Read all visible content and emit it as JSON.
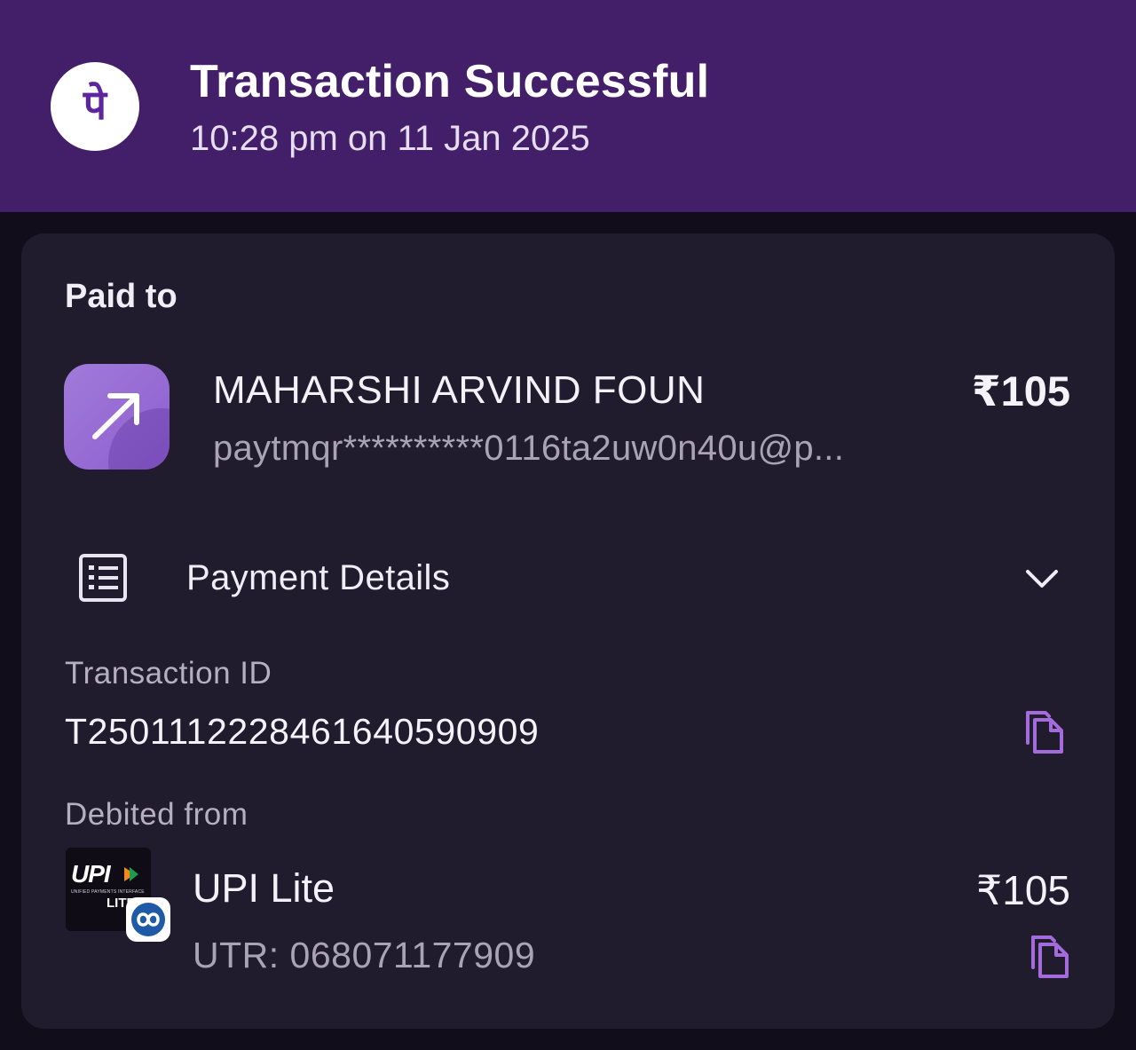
{
  "header": {
    "title": "Transaction Successful",
    "subtitle": "10:28 pm on 11 Jan 2025",
    "logo_glyph": "पे",
    "colors": {
      "background": "#431e69",
      "logo_fg": "#5f259f"
    }
  },
  "paid_to": {
    "label": "Paid to",
    "payee_name": "MAHARSHI ARVIND FOUN",
    "payee_upi": "paytmqr**********0116ta2uw0n40u@p...",
    "amount": "₹105",
    "avatar_icon": "arrow-up-right-icon"
  },
  "payment_details": {
    "label": "Payment Details",
    "expand_icon": "chevron-down-icon",
    "transaction_id_label": "Transaction ID",
    "transaction_id": "T2501112228461640590909",
    "debited_from_label": "Debited from",
    "wallet_name": "UPI Lite",
    "utr": "UTR: 068071177909",
    "wallet_amount": "₹105",
    "upi_logo": {
      "mark": "UPI",
      "tagline": "UNIFIED PAYMENTS INTERFACE",
      "variant": "LITE"
    }
  },
  "colors": {
    "page_background": "#110d1a",
    "card_background": "#211b2e",
    "accent": "#a46bdc",
    "secondary_text": "#a9a3b3"
  }
}
